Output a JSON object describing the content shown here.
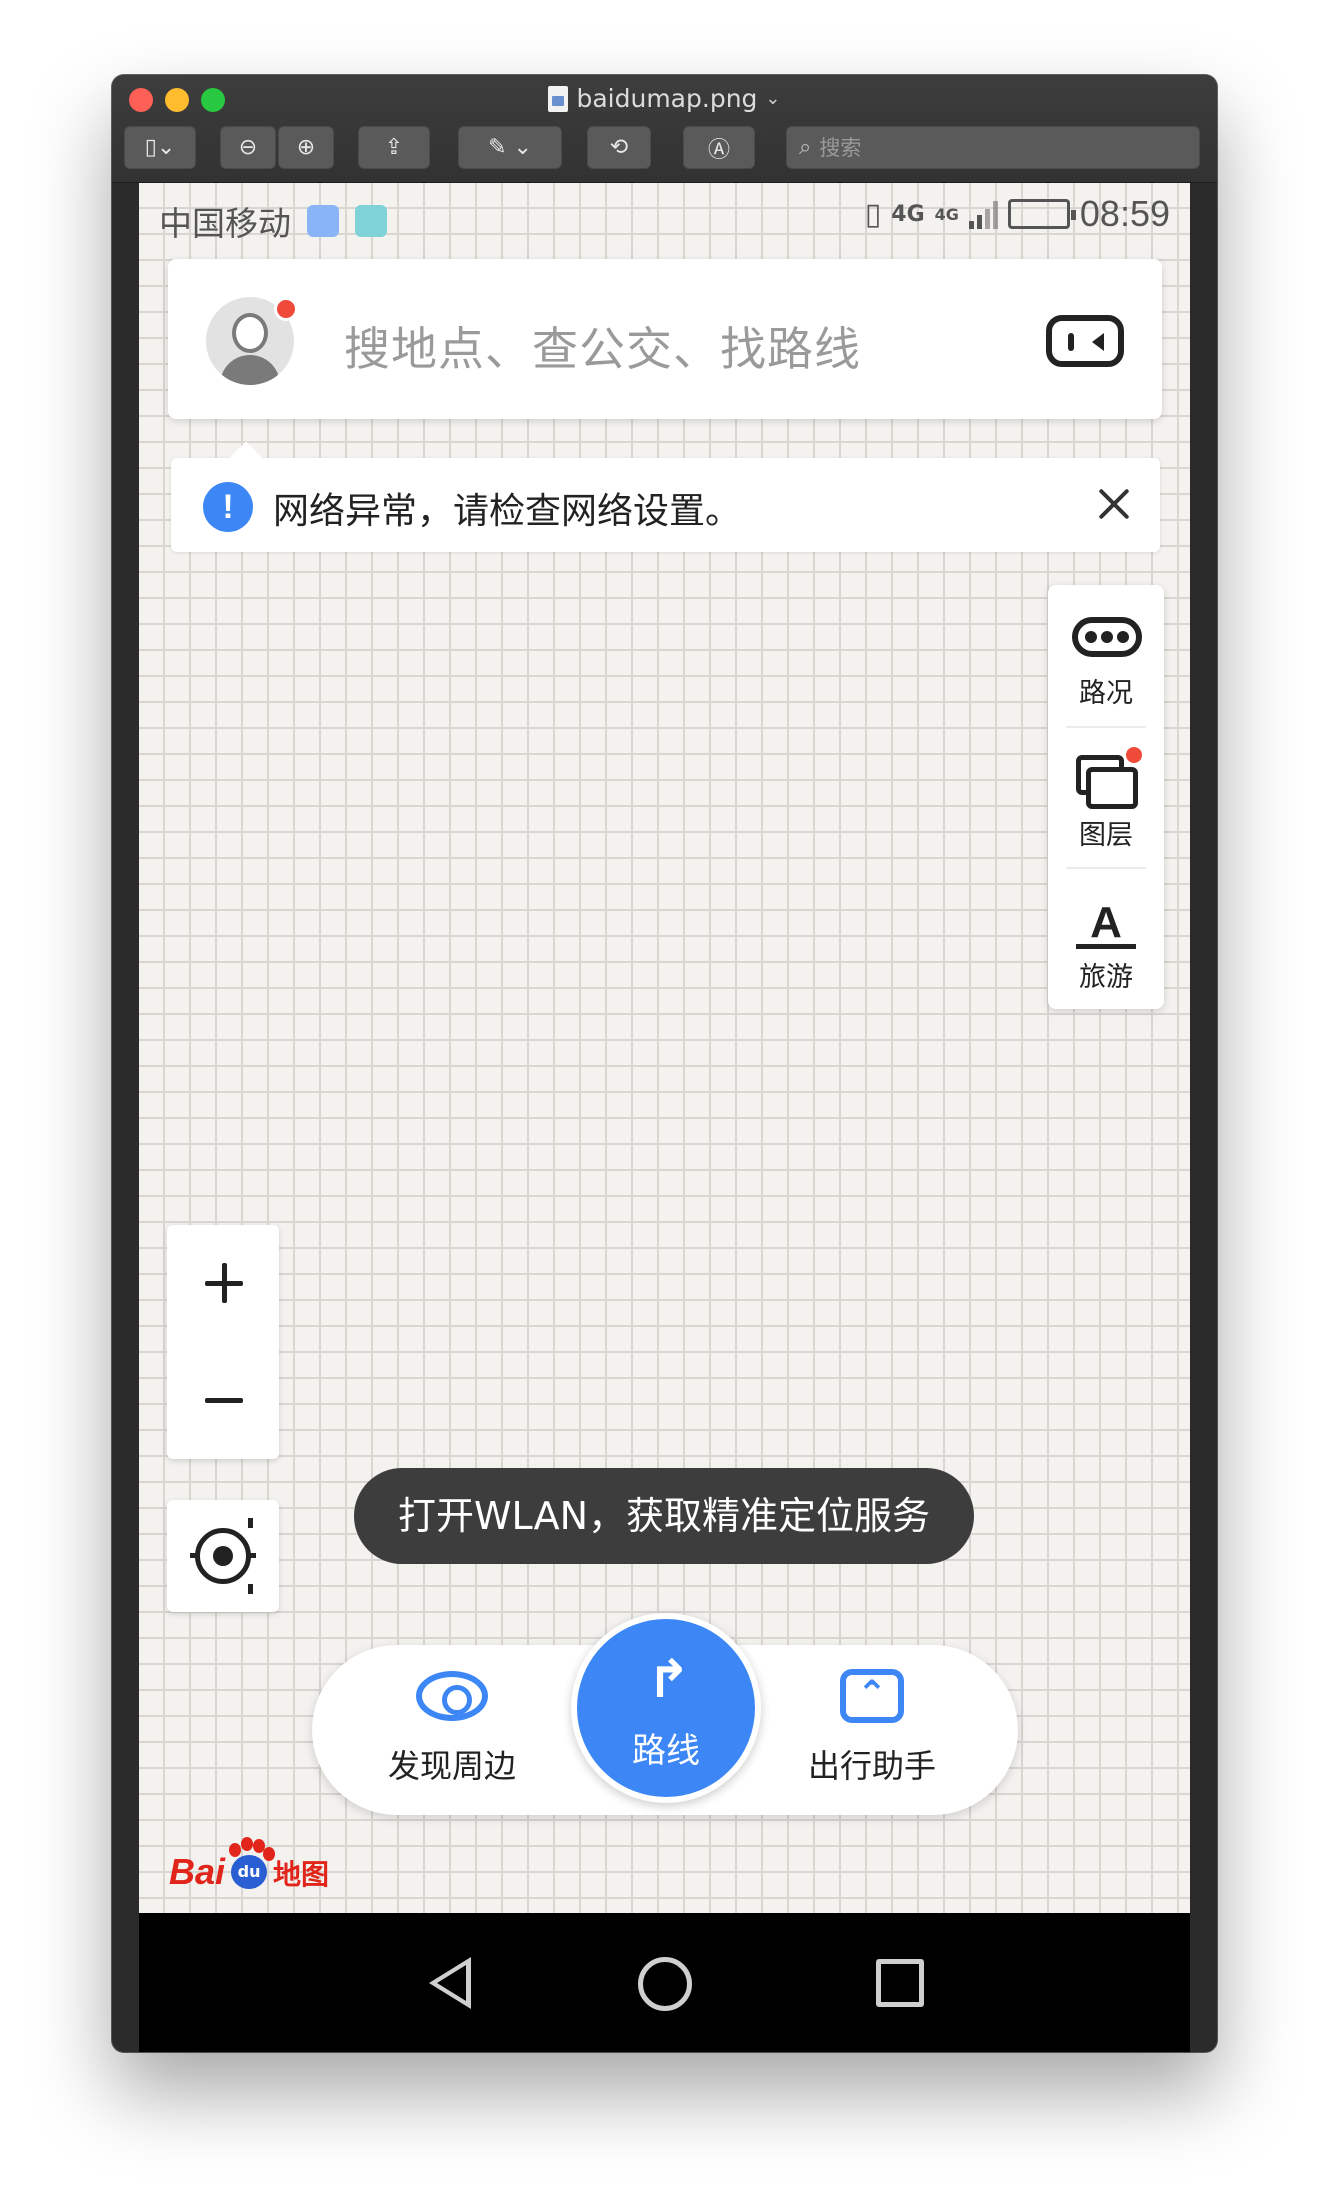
{
  "window": {
    "title": "baidumap.png",
    "search_placeholder": "搜索"
  },
  "statusbar": {
    "carrier": "中国移动",
    "network_left": "4G",
    "network_right": "4G",
    "time": "08:59"
  },
  "search": {
    "placeholder": "搜地点、查公交、找路线"
  },
  "notice": {
    "icon_text": "!",
    "text": "网络异常，请检查网络设置。"
  },
  "side_panel": {
    "items": [
      {
        "label": "路况",
        "icon": "traffic-icon"
      },
      {
        "label": "图层",
        "icon": "layers-icon"
      },
      {
        "label": "旅游",
        "icon": "travel-icon"
      }
    ],
    "travel_icon_glyph": "A"
  },
  "toast": {
    "text": "打开WLAN，获取精准定位服务"
  },
  "bottom_bar": {
    "left_label": "发现周边",
    "route_label": "路线",
    "right_label": "出行助手"
  },
  "logo": {
    "bai": "Bai",
    "du": "du",
    "map": "地图"
  },
  "colors": {
    "accent": "#3c86f5",
    "alert_dot": "#f04a3a",
    "logo_red": "#e1251b",
    "logo_blue": "#2a5fd4"
  }
}
